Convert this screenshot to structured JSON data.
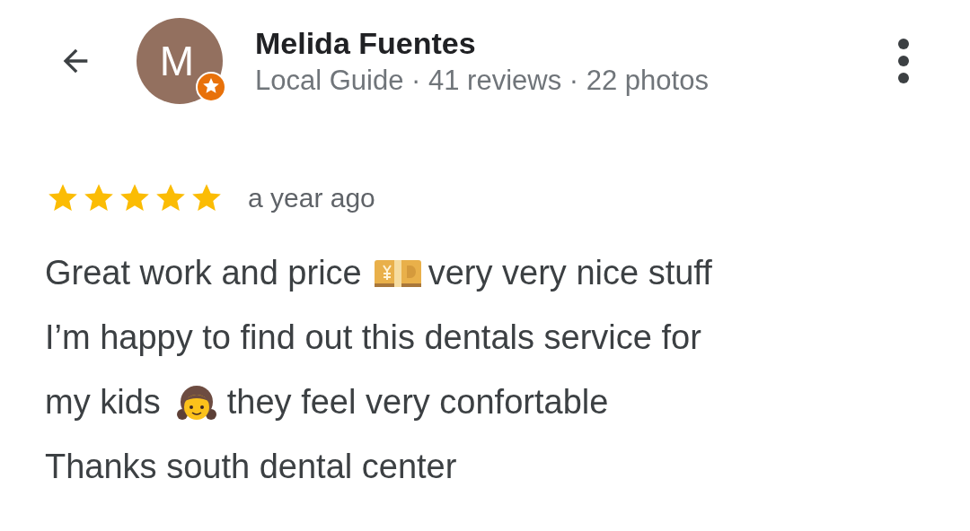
{
  "reviewer": {
    "avatar_letter": "M",
    "local_guide_badge": true,
    "name": "Melida Fuentes",
    "stats": "Local Guide · 41 reviews · 22 photos"
  },
  "review": {
    "stars": 5,
    "time": "a year ago",
    "lines": [
      {
        "parts": [
          {
            "kind": "text",
            "text": "Great work and price"
          },
          {
            "kind": "banknote"
          },
          {
            "kind": "text",
            "text": "very very nice stuff"
          }
        ]
      },
      {
        "parts": [
          {
            "kind": "text",
            "text": "I’m happy to find out this dentals service for"
          }
        ]
      },
      {
        "parts": [
          {
            "kind": "text",
            "text": "my kids"
          },
          {
            "kind": "girl"
          },
          {
            "kind": "text",
            "text": "they feel very confortable"
          }
        ]
      },
      {
        "parts": [
          {
            "kind": "text",
            "text": "Thanks south dental center"
          }
        ]
      }
    ]
  }
}
